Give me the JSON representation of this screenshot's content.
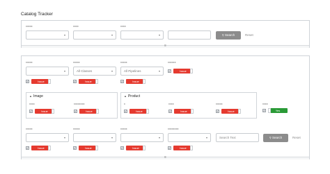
{
  "page": {
    "title": "Catalog Tracker"
  },
  "top_filter": {
    "labels": [
      "xxxxx",
      "xxxx",
      "xxxx"
    ],
    "search_label": "Search",
    "reset_label": "Reset"
  },
  "main": {
    "row1": {
      "labels": [
        "xxxxx",
        "xxxxx",
        "xxxxx",
        "xxxxxx"
      ],
      "select_values": [
        "",
        "All Classes",
        "All Pipelines"
      ],
      "toggle_labels": [
        "Issue",
        "Issue",
        "Issue",
        "Issue"
      ]
    },
    "group_image": {
      "title": "Image",
      "labels": [
        "xxxx",
        "xxxxxxxx"
      ],
      "toggle_labels": [
        "Issue",
        "Issue"
      ]
    },
    "group_product": {
      "title": "Product",
      "labels": [
        "x",
        "xxxx",
        "xxxxx"
      ],
      "toggle_labels": [
        "Issue",
        "Issue",
        "Issue"
      ]
    },
    "standalone": {
      "label": "xxxx",
      "toggle_label": "Yes"
    },
    "row3": {
      "labels": [
        "xxxxx",
        "xxxxx",
        "xxxxx",
        "xxxxxxxx"
      ],
      "search_placeholder": "Search Text",
      "search_label": "Search",
      "reset_label": "Reset",
      "toggle_labels": [
        "Issue",
        "Issue",
        "Issue",
        "Issue"
      ]
    }
  },
  "colors": {
    "issue": "#e53a2f",
    "yes": "#2a9a36",
    "search_button": "#8c8c8c"
  },
  "icons": {
    "caret": "chevron-down-icon",
    "collapse": "chevron-collapse-icon",
    "group": "triangle-icon"
  }
}
